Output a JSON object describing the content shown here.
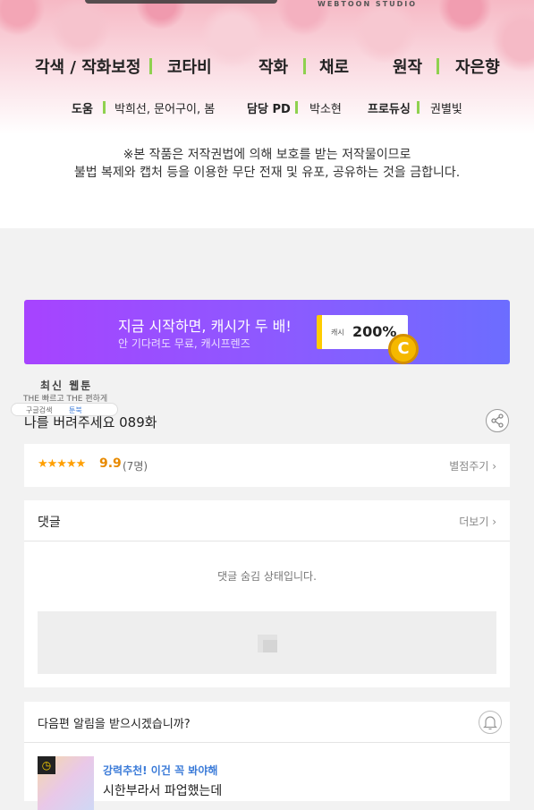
{
  "header": {
    "studio": "WEBTOON STUDIO",
    "credits_row1": [
      {
        "role": "각색 / 작화보정",
        "name": "코타비"
      },
      {
        "role": "작화",
        "name": "채로"
      },
      {
        "role": "원작",
        "name": "자은향"
      }
    ],
    "credits_row2": [
      {
        "role": "도움",
        "name": "박희선, 문어구이, 봄"
      },
      {
        "role": "담당 PD",
        "name": "박소현"
      },
      {
        "role": "프로듀싱",
        "name": "권별빛"
      }
    ],
    "notice_line1": "※본 작품은 저작권법에 의해 보호를 받는 저작물이므로",
    "notice_line2": "불법 복제와 캡처 등을 이용한 무단 전재 및 유포, 공유하는 것을 금합니다."
  },
  "banner": {
    "title": "지금 시작하면, 캐시가 두 배!",
    "subtitle": "안 기다려도 무료, 캐시프렌즈",
    "cash_label": "캐시",
    "percent": "200%",
    "coin": "C"
  },
  "watermark": {
    "title": "최신 웹툰",
    "tagline": "THE 빠르고 THE 편하게",
    "search": "구글검색",
    "site": "툰북"
  },
  "episode": {
    "title": "나를 버려주세요 089화"
  },
  "rating": {
    "stars": "★★★★★",
    "score": "9.9",
    "count": "(7명)",
    "rate_button": "별점주기 ›"
  },
  "comments": {
    "heading": "댓글",
    "more": "더보기 ›",
    "hidden_text": "댓글 숨김 상태입니다."
  },
  "alert": {
    "question": "다음편 알림을 받으시겠습니까?",
    "rec_label": "강력추천! 이건 꼭 봐야해",
    "rec_title": "시한부라서 파업했는데"
  },
  "colors": {
    "accent_green": "#8fd14f",
    "banner_purple": "#a743ff",
    "star": "#ff9f00",
    "link_blue": "#3b7bd8"
  }
}
